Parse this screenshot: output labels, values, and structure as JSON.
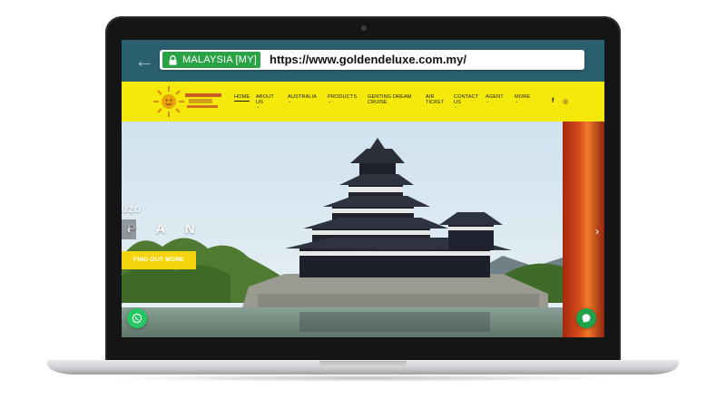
{
  "browser": {
    "back_icon": "arrow-left-icon",
    "secure_label": "MALAYSIA [MY]",
    "url": "https://www.goldendeluxe.com.my/"
  },
  "nav": {
    "items": [
      {
        "label": "HOME",
        "dropdown": false,
        "active": true
      },
      {
        "label": "ABOUT US",
        "dropdown": true
      },
      {
        "label": "AUSTRALIA",
        "dropdown": true
      },
      {
        "label": "PRODUCTS",
        "dropdown": true
      },
      {
        "label": "GENTING DREAM CRUISE",
        "dropdown": false
      },
      {
        "label": "AIR TICKET",
        "dropdown": false
      },
      {
        "label": "CONTACT US",
        "dropdown": true
      },
      {
        "label": "AGENT",
        "dropdown": true
      },
      {
        "label": "MORE",
        "dropdown": true
      }
    ],
    "caret": "⌄",
    "social": {
      "facebook": "f",
      "instagram": "◎"
    }
  },
  "hero": {
    "tag": "UZO",
    "title": "P A N",
    "cta_label": "FIND OUT MORE",
    "prev_glyph": "‹",
    "next_glyph": "›"
  },
  "colors": {
    "header_bg": "#f5e90b",
    "browser_bar": "#2a5f6e",
    "secure_green": "#2aa246",
    "cta_yellow": "#f5d50e",
    "whatsapp_green": "#23c862"
  }
}
